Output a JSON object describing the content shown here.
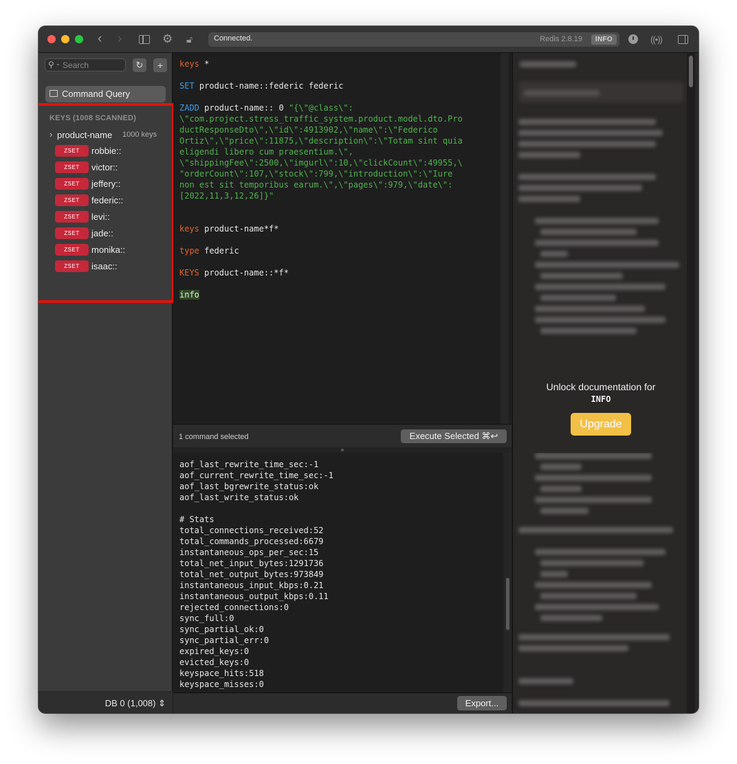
{
  "toolbar": {
    "status_text": "Connected.",
    "server_version": "Redis 2.8.19",
    "mode_badge": "INFO"
  },
  "icons": {
    "back": "chevron-left-icon",
    "forward": "chevron-right-icon",
    "sidebar_toggle": "sidebar-icon",
    "settings": "gear-icon",
    "lock": "lock-icon",
    "history": "clock-icon",
    "broadcast": "broadcast-icon",
    "panel_toggle": "panel-icon",
    "search": "search-icon",
    "refresh": "refresh-icon",
    "add": "plus-icon",
    "terminal": "terminal-icon"
  },
  "sidebar": {
    "search_placeholder": "Search",
    "command_query_label": "Command Query",
    "keys_header": "KEYS (1008 SCANNED)",
    "folder": {
      "name": "product-name",
      "count": "1000 keys"
    },
    "keys": [
      {
        "type": "ZSET",
        "name": "robbie::"
      },
      {
        "type": "ZSET",
        "name": "victor::"
      },
      {
        "type": "ZSET",
        "name": "jeffery::"
      },
      {
        "type": "ZSET",
        "name": "federic::"
      },
      {
        "type": "ZSET",
        "name": "levi::"
      },
      {
        "type": "ZSET",
        "name": "jade::"
      },
      {
        "type": "ZSET",
        "name": "monika::"
      },
      {
        "type": "ZSET",
        "name": "isaac::"
      }
    ],
    "db_selector": "DB 0 (1,008)"
  },
  "editor": {
    "line1_cmd": "keys",
    "line1_arg": " *",
    "line2_cmd": "SET",
    "line2_arg": " product-name::federic federic",
    "line3_cmd": "ZADD",
    "line3_arg": " product-name:: 0 ",
    "json_lines": [
      "\"{\\\"@class\\\":",
      "\\\"com.project.stress_traffic_system.product.model.dto.Pro",
      "ductResponseDto\\\",\\\"id\\\":4913902,\\\"name\\\":\\\"Federico",
      "Ortiz\\\",\\\"price\\\":11875,\\\"description\\\":\\\"Totam sint quia",
      "eligendi libero cum praesentium.\\\",",
      "\\\"shippingFee\\\":2500,\\\"imgurl\\\":10,\\\"clickCount\\\":49955,\\",
      "\"orderCount\\\":107,\\\"stock\\\":799,\\\"introduction\\\":\\\"Iure",
      "non est sit temporibus earum.\\\",\\\"pages\\\":979,\\\"date\\\":",
      "[2022,11,3,12,26]}\""
    ],
    "line4_cmd": "keys",
    "line4_arg": " product-name*f*",
    "line5_cmd": "type",
    "line5_arg": " federic",
    "line6_cmd": "KEYS",
    "line6_arg": " product-name::*f*",
    "line7_cmd": "info",
    "selection_status": "1 command selected",
    "execute_label": "Execute Selected ⌘↩"
  },
  "output": {
    "lines": [
      "aof_last_rewrite_time_sec:-1",
      "aof_current_rewrite_time_sec:-1",
      "aof_last_bgrewrite_status:ok",
      "aof_last_write_status:ok",
      "",
      "# Stats",
      "total_connections_received:52",
      "total_commands_processed:6679",
      "instantaneous_ops_per_sec:15",
      "total_net_input_bytes:1291736",
      "total_net_output_bytes:973849",
      "instantaneous_input_kbps:0.21",
      "instantaneous_output_kbps:0.11",
      "rejected_connections:0",
      "sync_full:0",
      "sync_partial_ok:0",
      "sync_partial_err:0",
      "expired_keys:0",
      "evicted_keys:0",
      "keyspace_hits:518",
      "keyspace_misses:0"
    ],
    "export_label": "Export..."
  },
  "docs": {
    "unlock_title": "Unlock documentation for",
    "unlock_command": "INFO",
    "upgrade_label": "Upgrade"
  },
  "colors": {
    "zset_badge": "#c5283a",
    "keyword_orange": "#e0632f",
    "keyword_blue": "#3f9be8",
    "string_green": "#4fb34d",
    "upgrade_button": "#f2c046",
    "highlight_frame": "#e3120b"
  }
}
